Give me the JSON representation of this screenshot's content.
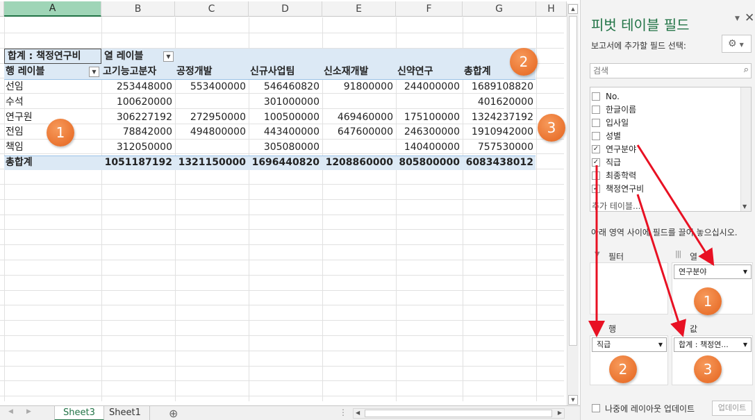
{
  "columns": [
    "A",
    "B",
    "C",
    "D",
    "E",
    "F",
    "G",
    "H"
  ],
  "pivot": {
    "value_label": "합계 : 책정연구비",
    "col_label": "열 레이블",
    "row_label": "행 레이블",
    "headers": [
      "고기능고분자",
      "공정개발",
      "신규사업팀",
      "신소재개발",
      "신약연구",
      "총합계"
    ],
    "rows": [
      {
        "label": "선임",
        "values": [
          "253448000",
          "553400000",
          "546460820",
          "91800000",
          "244000000",
          "1689108820"
        ]
      },
      {
        "label": "수석",
        "values": [
          "100620000",
          "",
          "301000000",
          "",
          "",
          "401620000"
        ]
      },
      {
        "label": "연구원",
        "values": [
          "306227192",
          "272950000",
          "100500000",
          "469460000",
          "175100000",
          "1324237192"
        ]
      },
      {
        "label": "전임",
        "values": [
          "78842000",
          "494800000",
          "443400000",
          "647600000",
          "246300000",
          "1910942000"
        ]
      },
      {
        "label": "책임",
        "values": [
          "312050000",
          "",
          "305080000",
          "",
          "140400000",
          "757530000"
        ]
      }
    ],
    "total": {
      "label": "총합계",
      "values": [
        "1051187192",
        "1321150000",
        "1696440820",
        "1208860000",
        "805800000",
        "6083438012"
      ]
    }
  },
  "badges": {
    "sheet": [
      "1",
      "2",
      "3"
    ],
    "pane": [
      "1",
      "2",
      "3"
    ]
  },
  "tabs": [
    "Sheet3",
    "Sheet1"
  ],
  "add_sheet": "⊕",
  "pane": {
    "title": "피벗 테이블 필드",
    "subtitle": "보고서에 추가할 필드 선택:",
    "search_placeholder": "검색",
    "fields": [
      {
        "name": "No.",
        "checked": false
      },
      {
        "name": "한글이름",
        "checked": false
      },
      {
        "name": "입사일",
        "checked": false
      },
      {
        "name": "성별",
        "checked": false
      },
      {
        "name": "연구분야",
        "checked": true
      },
      {
        "name": "직급",
        "checked": true
      },
      {
        "name": "최종학력",
        "checked": false
      },
      {
        "name": "책정연구비",
        "checked": true
      }
    ],
    "more_tables": "추가 테이블...",
    "drag_hint": "아래 영역 사이에 필드를 끌어 놓으십시오.",
    "areas": {
      "filter": "필터",
      "columns": "열",
      "rows": "행",
      "values": "값"
    },
    "chips": {
      "columns": "연구분야",
      "rows": "직급",
      "values": "합계 : 책정연..."
    },
    "defer_label": "나중에 레이아웃 업데이트",
    "update_button": "업데이트"
  },
  "colors": {
    "accent": "#217346",
    "arrow": "#e81123",
    "badge": "#ee7d31",
    "band": "#dce9f5"
  }
}
